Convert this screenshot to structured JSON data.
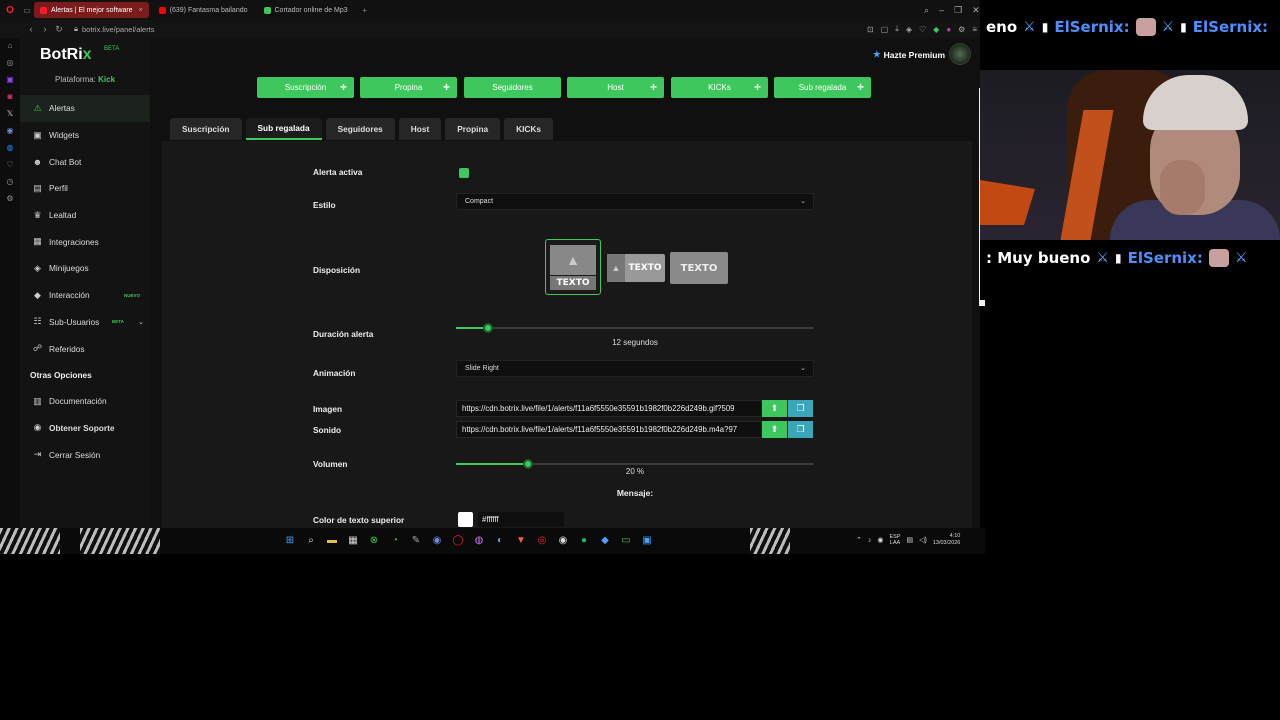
{
  "browser": {
    "tabs": [
      {
        "label": "Alertas | El mejor software",
        "active": true,
        "color": "#ff1b2d"
      },
      {
        "label": "(639) Fantasma bailando",
        "active": false,
        "color": "#ff0000"
      },
      {
        "label": "Cortador online de Mp3",
        "active": false,
        "color": "#3ec75c"
      }
    ],
    "new_tab": "+",
    "url": "botrix.live/panel/alerts"
  },
  "sidebar": {
    "logo_main": "BotRi",
    "logo_x": "x",
    "logo_badge": "BETA",
    "platform_label": "Plataforma:",
    "platform_value": "Kick",
    "items": [
      {
        "label": "Alertas",
        "icon": "⚠"
      },
      {
        "label": "Widgets",
        "icon": "▣"
      },
      {
        "label": "Chat Bot",
        "icon": "☻"
      },
      {
        "label": "Perfil",
        "icon": "▤"
      },
      {
        "label": "Lealtad",
        "icon": "♛"
      },
      {
        "label": "Integraciones",
        "icon": "▦"
      },
      {
        "label": "Minijuegos",
        "icon": "◈"
      },
      {
        "label": "Interacción",
        "icon": "◆",
        "badge": "NUEVO"
      },
      {
        "label": "Sub-Usuarios",
        "icon": "☷",
        "badge": "BETA"
      },
      {
        "label": "Referidos",
        "icon": "☍"
      }
    ],
    "section_title": "Otras Opciones",
    "other_items": [
      {
        "label": "Documentación",
        "icon": "▥"
      },
      {
        "label": "Obtener Soporte",
        "icon": "◉"
      },
      {
        "label": "Cerrar Sesión",
        "icon": "⇥"
      }
    ]
  },
  "header": {
    "premium_label": "Hazte Premium"
  },
  "alert_types": [
    "Suscripción",
    "Propina",
    "Seguidores",
    "Host",
    "KICKs",
    "Sub regalada"
  ],
  "tabs": [
    "Suscripción",
    "Sub regalada",
    "Seguidores",
    "Host",
    "Propina",
    "KICKs"
  ],
  "form": {
    "active_label": "Alerta activa",
    "active": true,
    "style_label": "Estilo",
    "style_value": "Compact",
    "layout_label": "Disposición",
    "layout_text": "TEXTO",
    "duration_label": "Duración alerta",
    "duration_value": "12 segundos",
    "duration_fraction": 0.09,
    "animation_label": "Animación",
    "animation_value": "Slide Right",
    "image_label": "Imagen",
    "image_url": "https://cdn.botrix.live/file/1/alerts/f11a6f5550e35591b1982f0b226d249b.gif?509",
    "sound_label": "Sonido",
    "sound_url": "https://cdn.botrix.live/file/1/alerts/f11a6f5550e35591b1982f0b226d249b.m4a?97",
    "volume_label": "Volumen",
    "volume_value": "20 %",
    "volume_fraction": 0.2,
    "message_title": "Mensaje:",
    "top_color_label": "Color de texto superior",
    "top_color_value": "#ffffff"
  },
  "taskbar": {
    "lang_top": "ESP",
    "lang_bottom": "LAA",
    "time": "4:10",
    "date": "13/03/2026"
  },
  "stream": {
    "line1_word": "eno",
    "line1_user": "ElSernix:",
    "line2_word": ": Muy bueno",
    "line2_user": "ElSernix:"
  },
  "colors": {
    "accent": "#3ec75c",
    "teal": "#3aa6b9",
    "bg": "#101010"
  }
}
